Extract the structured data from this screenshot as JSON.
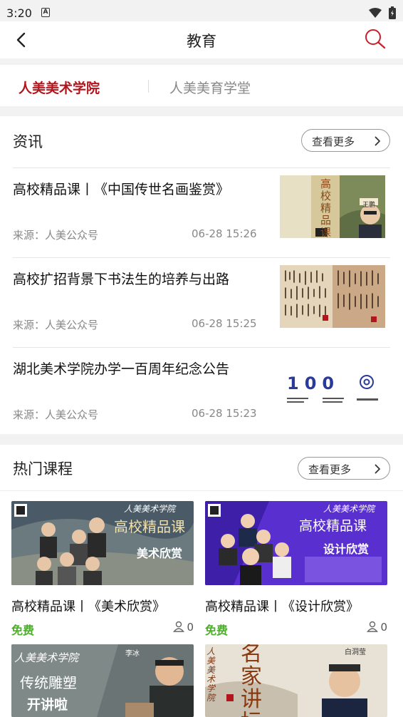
{
  "status_bar": {
    "time": "3:20",
    "notification_badge": "A"
  },
  "header": {
    "title": "教育"
  },
  "tabs": [
    {
      "label": "人美美术学院",
      "active": true
    },
    {
      "label": "人美美育学堂",
      "active": false
    }
  ],
  "news": {
    "title": "资讯",
    "more_label": "查看更多",
    "items": [
      {
        "headline": "高校精品课丨《中国传世名画鉴赏》",
        "source": "来源：人美公众号",
        "date": "06-28 15:26",
        "thumb_text": "高校精品课",
        "thumb_name": "王鹏"
      },
      {
        "headline": "高校扩招背景下书法生的培养与出路",
        "source": "来源：人美公众号",
        "date": "06-28 15:25"
      },
      {
        "headline": "湖北美术学院办学一百周年纪念公告",
        "source": "来源：人美公众号",
        "date": "06-28 15:23",
        "thumb_text": "100"
      }
    ]
  },
  "courses": {
    "title": "热门课程",
    "more_label": "查看更多",
    "items": [
      {
        "title": "高校精品课丨《美术欣赏》",
        "price": "免费",
        "learners": "0",
        "cover_brand": "人美美术学院",
        "cover_title": "高校精品课",
        "cover_subtitle": "美术欣赏"
      },
      {
        "title": "高校精品课丨《设计欣赏》",
        "price": "免费",
        "learners": "0",
        "cover_brand": "人美美术学院",
        "cover_title": "高校精品课",
        "cover_subtitle": "设计欣赏"
      },
      {
        "cover_brand": "人美美术学院",
        "cover_title": "传统雕塑",
        "cover_subtitle": "开讲啦",
        "cover_name": "李冰"
      },
      {
        "cover_brand": "人美美术学院",
        "cover_title": "名家讲坛",
        "cover_name": "白洞莹"
      }
    ]
  },
  "colors": {
    "accent_red": "#b3151c",
    "free_green": "#4caf2a",
    "purple": "#5a2fd0"
  }
}
